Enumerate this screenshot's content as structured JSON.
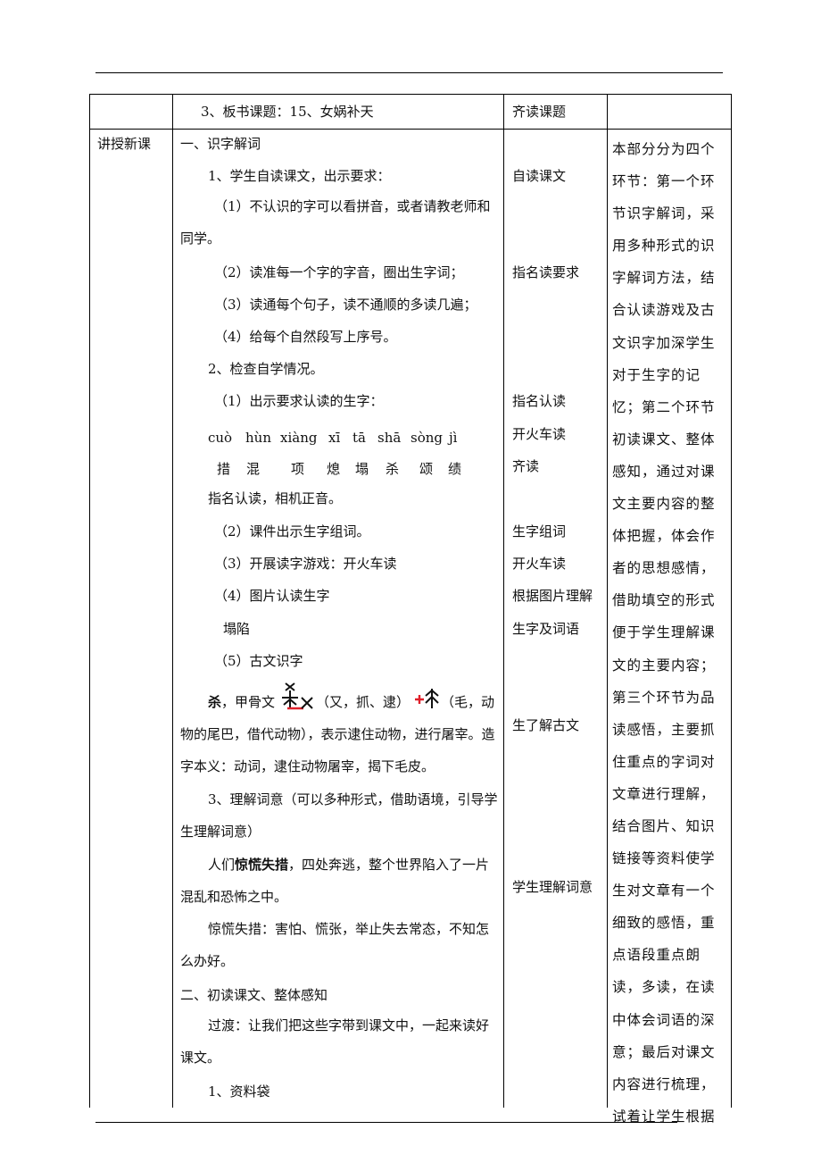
{
  "row0": {
    "col1": "",
    "col2": "3、板书课题：15、女娲补天",
    "col3": "齐读课题",
    "col4": ""
  },
  "row1": {
    "col1": "讲授新课",
    "content": {
      "l1": "一、识字解词",
      "l2": "1、学生自读课文，出示要求：",
      "l3": "（1）不认识的字可以看拼音，或者请教老师和同学。",
      "l4": "（2）读准每一个字的字音，圈出生字词；",
      "l5": "（3）读通每个句子，读不通顺的多读几遍；",
      "l6": "（4）给每个自然段写上序号。",
      "l7": "2、检查自学情况。",
      "l8": "（1）出示要求认读的生字：",
      "pinyin": [
        "cuò",
        "hùn",
        "xiàng",
        "xī",
        "tā",
        "shā",
        "sòng",
        "jì"
      ],
      "hanzi": [
        "措",
        "混",
        "项",
        "熄",
        "塌",
        "杀",
        "颂",
        "绩"
      ],
      "l9": "指名认读，相机正音。",
      "l10": "（2）课件出示生字组词。",
      "l11": "（3）开展读字游戏：开火车读",
      "l12": "（4）图片认读生字",
      "l13": "塌陷",
      "l14": "（5）古文识字",
      "guwen_char": "杀",
      "guwen_a": "，甲骨文",
      "guwen_b": "（又，抓、逮）",
      "guwen_c": "（毛，动物的尾巴，借代动物），表示逮住动物，进行屠宰。造字本义：动词，逮住动物屠宰，揭下毛皮。",
      "l15": "3、理解词意（可以多种形式，借助语境，引导学生理解词意）",
      "l16_pre": "人们",
      "l16_bold": "惊慌失措",
      "l16_post": "，四处奔逃，整个世界陷入了一片混乱和恐怖之中。",
      "l17": "惊慌失措：害怕、慌张，举止失去常态，不知怎么办好。",
      "l18": "二、初读课文、整体感知",
      "l19": "过渡：让我们把这些字带到课文中，一起来读好课文。",
      "l20": "1、资料袋"
    },
    "col3": {
      "a1": "自读课文",
      "a2": "指名读要求",
      "a3": "指名认读",
      "a4": "开火车读",
      "a5": "齐读",
      "a6": "生字组词",
      "a7": "开火车读",
      "a8": "根据图片理解",
      "a9": "生字及词语",
      "a10": "生了解古文",
      "a11": "学生理解词意"
    },
    "col4": "本部分分为四个环节：第一个环节识字解词，采用多种形式的识字解词方法，结合认读游戏及古文识字加深学生对于生字的记忆；第二个环节初读课文、整体感知，通过对课文主要内容的整体把握，体会作者的思想感情，借助填空的形式便于学生理解课文的主要内容；第三个环节为品读感悟，主要抓住重点的字词对文章进行理解，结合图片、知识链接等资料使学生对文章有一个细致的感悟，重点语段重点朗读，多读，在读中体会词语的深意；最后对课文内容进行梳理，试着让学生根据"
  },
  "colors": {
    "oracle_red": "#e0202a",
    "ink": "#111111"
  }
}
